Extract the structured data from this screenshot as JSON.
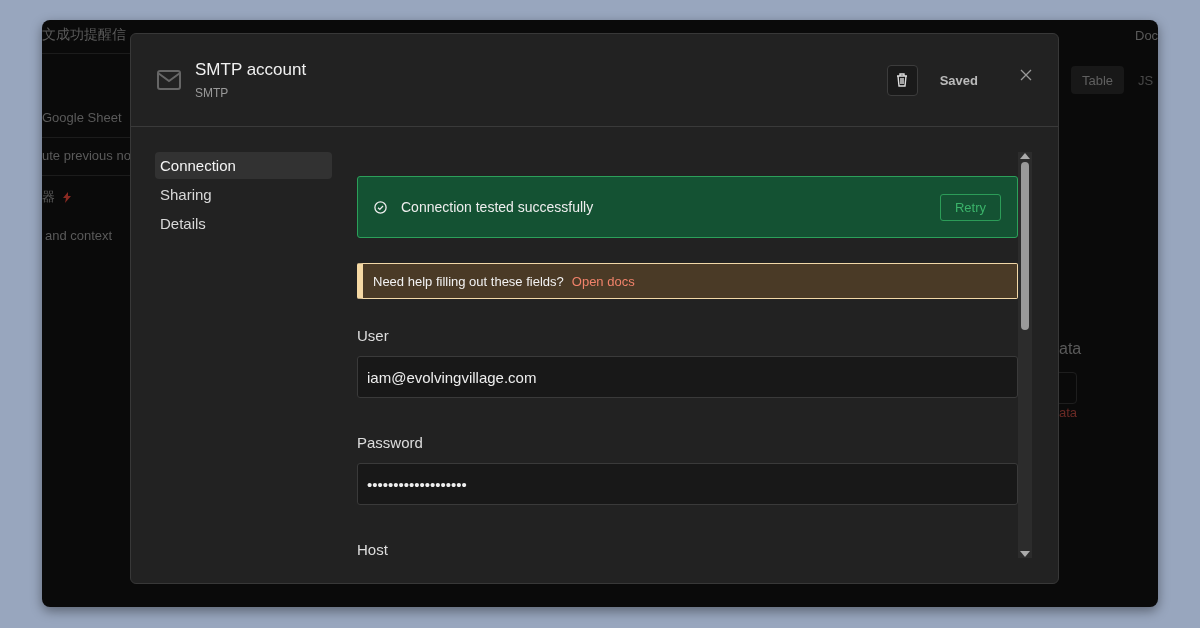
{
  "background": {
    "title": "文成功提醒信",
    "top_right": "Doc",
    "steps": [
      {
        "label": "Google Sheet",
        "kind": "text"
      },
      {
        "label": "ute previous no",
        "kind": "text"
      },
      {
        "label": "器",
        "kind": "trigger"
      },
      {
        "label": "and context",
        "kind": "text"
      }
    ],
    "tabs": [
      {
        "label": "Table",
        "selected": true
      },
      {
        "label": "JS",
        "selected": false
      }
    ],
    "panel_heading": "ata",
    "panel_link": "ata"
  },
  "modal": {
    "title": "SMTP account",
    "subtitle": "SMTP",
    "status": "Saved",
    "nav": [
      {
        "label": "Connection",
        "selected": true
      },
      {
        "label": "Sharing",
        "selected": false
      },
      {
        "label": "Details",
        "selected": false
      }
    ],
    "success_banner": {
      "message": "Connection tested successfully",
      "action": "Retry"
    },
    "help_banner": {
      "message": "Need help filling out these fields?",
      "link": "Open docs"
    },
    "fields": [
      {
        "label": "User",
        "value": "iam@evolvingvillage.com"
      },
      {
        "label": "Password",
        "value": "•••••••••••••••••••"
      },
      {
        "label": "Host"
      }
    ]
  }
}
